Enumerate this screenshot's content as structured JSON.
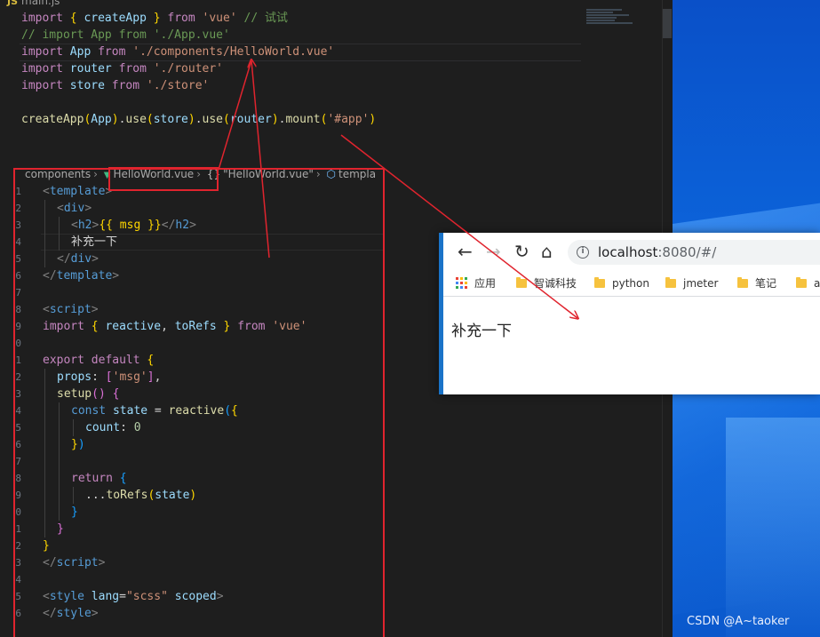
{
  "editor_top": {
    "tab_icon": "JS",
    "tab_title": "main.js",
    "lines": {
      "l1": {
        "a": "import",
        "b": "{",
        "c": "createApp",
        "d": "}",
        "e": "from",
        "f": "'vue'",
        "g": "// 试试"
      },
      "l2": "// import App from './App.vue'",
      "l3": {
        "a": "import",
        "b": "App",
        "c": "from",
        "d": "'./components/HelloWorld.vue'"
      },
      "l4": {
        "a": "import",
        "b": "router",
        "c": "from",
        "d": "'./router'"
      },
      "l5": {
        "a": "import",
        "b": "store",
        "c": "from",
        "d": "'./store'"
      },
      "l7": {
        "a": "createApp",
        "b": "App",
        "c": "use",
        "d": "store",
        "e": "use",
        "f": "router",
        "g": "mount",
        "h": "'#app'"
      }
    }
  },
  "editor_vue": {
    "breadcrumb": {
      "folder": "components",
      "file": "HelloWorld.vue",
      "symbol": "\"HelloWorld.vue\"",
      "node": "templa"
    },
    "gutter": [
      "1",
      "2",
      "3",
      "4",
      "5",
      "6",
      "7",
      "8",
      "9",
      "0",
      "1",
      "2",
      "3",
      "4",
      "5",
      "6",
      "7",
      "8",
      "9",
      "0",
      "1",
      "2",
      "3",
      "4",
      "5",
      "6"
    ],
    "code": {
      "template_open": "template",
      "div_open": "div",
      "h2_open": "h2",
      "mustache": "{{ msg }}",
      "h2_close": "h2",
      "chinese": "补充一下",
      "div_close": "div",
      "template_close": "template",
      "script_open": "script",
      "import_kw": "import",
      "reactive": "reactive",
      "toRefs": "toRefs",
      "from_kw": "from",
      "vue_str": "'vue'",
      "export_kw": "export",
      "default_kw": "default",
      "props_key": "props",
      "msg_str": "'msg'",
      "setup_fn": "setup",
      "const_kw": "const",
      "state_var": "state",
      "reactive_call": "reactive",
      "count_key": "count",
      "count_val": "0",
      "return_kw": "return",
      "spread": "...",
      "toRefs_call": "toRefs",
      "state_arg": "state",
      "script_close": "script",
      "style_tag": "style",
      "lang_attr": "lang",
      "lang_val": "\"scss\"",
      "scoped_attr": "scoped",
      "style_close": "style"
    }
  },
  "browser": {
    "url_host": "localhost",
    "url_rest": ":8080/#/",
    "bookmarks": [
      "应用",
      "智诚科技",
      "python",
      "jmeter",
      "笔记",
      "ap"
    ],
    "page_text": "补充一下"
  },
  "watermark": "CSDN @A~taoker",
  "colors": {
    "annotation_red": "#e0242e",
    "editor_bg": "#1e1e1e",
    "desktop_blue": "#0b5fd6"
  }
}
